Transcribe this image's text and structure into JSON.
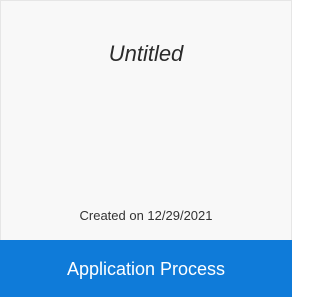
{
  "card": {
    "title": "Untitled",
    "created_text": "Created on 12/29/2021",
    "footer_label": "Application Process"
  },
  "colors": {
    "accent": "#0f7bd9",
    "card_background": "#f8f8f8",
    "text": "#2b2b2b"
  }
}
